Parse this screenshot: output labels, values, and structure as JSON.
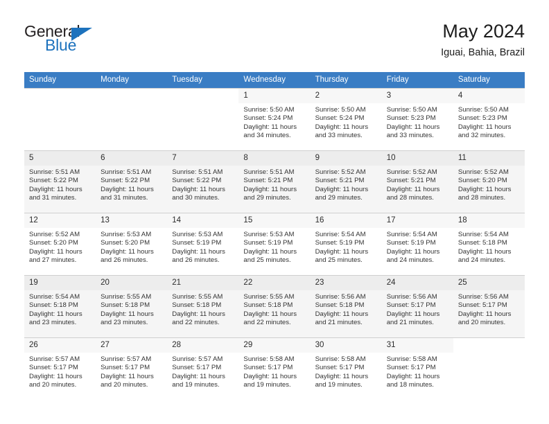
{
  "brand": {
    "name_top": "General",
    "name_bottom": "Blue",
    "triangle_color": "#1d72bd",
    "text_color": "#231f20"
  },
  "header": {
    "title": "May 2024",
    "subtitle": "Iguai, Bahia, Brazil"
  },
  "calendar": {
    "header_background": "#3a7dc4",
    "header_text_color": "#ffffff",
    "weekdays": [
      "Sunday",
      "Monday",
      "Tuesday",
      "Wednesday",
      "Thursday",
      "Friday",
      "Saturday"
    ],
    "labels": {
      "sunrise": "Sunrise:",
      "sunset": "Sunset:",
      "daylight": "Daylight:"
    },
    "weeks": [
      {
        "shaded": false,
        "days": [
          {
            "day": "",
            "sunrise": "",
            "sunset": "",
            "daylight_line1": "",
            "daylight_line2": ""
          },
          {
            "day": "",
            "sunrise": "",
            "sunset": "",
            "daylight_line1": "",
            "daylight_line2": ""
          },
          {
            "day": "",
            "sunrise": "",
            "sunset": "",
            "daylight_line1": "",
            "daylight_line2": ""
          },
          {
            "day": "1",
            "sunrise": "Sunrise: 5:50 AM",
            "sunset": "Sunset: 5:24 PM",
            "daylight_line1": "Daylight: 11 hours",
            "daylight_line2": "and 34 minutes."
          },
          {
            "day": "2",
            "sunrise": "Sunrise: 5:50 AM",
            "sunset": "Sunset: 5:24 PM",
            "daylight_line1": "Daylight: 11 hours",
            "daylight_line2": "and 33 minutes."
          },
          {
            "day": "3",
            "sunrise": "Sunrise: 5:50 AM",
            "sunset": "Sunset: 5:23 PM",
            "daylight_line1": "Daylight: 11 hours",
            "daylight_line2": "and 33 minutes."
          },
          {
            "day": "4",
            "sunrise": "Sunrise: 5:50 AM",
            "sunset": "Sunset: 5:23 PM",
            "daylight_line1": "Daylight: 11 hours",
            "daylight_line2": "and 32 minutes."
          }
        ]
      },
      {
        "shaded": true,
        "days": [
          {
            "day": "5",
            "sunrise": "Sunrise: 5:51 AM",
            "sunset": "Sunset: 5:22 PM",
            "daylight_line1": "Daylight: 11 hours",
            "daylight_line2": "and 31 minutes."
          },
          {
            "day": "6",
            "sunrise": "Sunrise: 5:51 AM",
            "sunset": "Sunset: 5:22 PM",
            "daylight_line1": "Daylight: 11 hours",
            "daylight_line2": "and 31 minutes."
          },
          {
            "day": "7",
            "sunrise": "Sunrise: 5:51 AM",
            "sunset": "Sunset: 5:22 PM",
            "daylight_line1": "Daylight: 11 hours",
            "daylight_line2": "and 30 minutes."
          },
          {
            "day": "8",
            "sunrise": "Sunrise: 5:51 AM",
            "sunset": "Sunset: 5:21 PM",
            "daylight_line1": "Daylight: 11 hours",
            "daylight_line2": "and 29 minutes."
          },
          {
            "day": "9",
            "sunrise": "Sunrise: 5:52 AM",
            "sunset": "Sunset: 5:21 PM",
            "daylight_line1": "Daylight: 11 hours",
            "daylight_line2": "and 29 minutes."
          },
          {
            "day": "10",
            "sunrise": "Sunrise: 5:52 AM",
            "sunset": "Sunset: 5:21 PM",
            "daylight_line1": "Daylight: 11 hours",
            "daylight_line2": "and 28 minutes."
          },
          {
            "day": "11",
            "sunrise": "Sunrise: 5:52 AM",
            "sunset": "Sunset: 5:20 PM",
            "daylight_line1": "Daylight: 11 hours",
            "daylight_line2": "and 28 minutes."
          }
        ]
      },
      {
        "shaded": false,
        "days": [
          {
            "day": "12",
            "sunrise": "Sunrise: 5:52 AM",
            "sunset": "Sunset: 5:20 PM",
            "daylight_line1": "Daylight: 11 hours",
            "daylight_line2": "and 27 minutes."
          },
          {
            "day": "13",
            "sunrise": "Sunrise: 5:53 AM",
            "sunset": "Sunset: 5:20 PM",
            "daylight_line1": "Daylight: 11 hours",
            "daylight_line2": "and 26 minutes."
          },
          {
            "day": "14",
            "sunrise": "Sunrise: 5:53 AM",
            "sunset": "Sunset: 5:19 PM",
            "daylight_line1": "Daylight: 11 hours",
            "daylight_line2": "and 26 minutes."
          },
          {
            "day": "15",
            "sunrise": "Sunrise: 5:53 AM",
            "sunset": "Sunset: 5:19 PM",
            "daylight_line1": "Daylight: 11 hours",
            "daylight_line2": "and 25 minutes."
          },
          {
            "day": "16",
            "sunrise": "Sunrise: 5:54 AM",
            "sunset": "Sunset: 5:19 PM",
            "daylight_line1": "Daylight: 11 hours",
            "daylight_line2": "and 25 minutes."
          },
          {
            "day": "17",
            "sunrise": "Sunrise: 5:54 AM",
            "sunset": "Sunset: 5:19 PM",
            "daylight_line1": "Daylight: 11 hours",
            "daylight_line2": "and 24 minutes."
          },
          {
            "day": "18",
            "sunrise": "Sunrise: 5:54 AM",
            "sunset": "Sunset: 5:18 PM",
            "daylight_line1": "Daylight: 11 hours",
            "daylight_line2": "and 24 minutes."
          }
        ]
      },
      {
        "shaded": true,
        "days": [
          {
            "day": "19",
            "sunrise": "Sunrise: 5:54 AM",
            "sunset": "Sunset: 5:18 PM",
            "daylight_line1": "Daylight: 11 hours",
            "daylight_line2": "and 23 minutes."
          },
          {
            "day": "20",
            "sunrise": "Sunrise: 5:55 AM",
            "sunset": "Sunset: 5:18 PM",
            "daylight_line1": "Daylight: 11 hours",
            "daylight_line2": "and 23 minutes."
          },
          {
            "day": "21",
            "sunrise": "Sunrise: 5:55 AM",
            "sunset": "Sunset: 5:18 PM",
            "daylight_line1": "Daylight: 11 hours",
            "daylight_line2": "and 22 minutes."
          },
          {
            "day": "22",
            "sunrise": "Sunrise: 5:55 AM",
            "sunset": "Sunset: 5:18 PM",
            "daylight_line1": "Daylight: 11 hours",
            "daylight_line2": "and 22 minutes."
          },
          {
            "day": "23",
            "sunrise": "Sunrise: 5:56 AM",
            "sunset": "Sunset: 5:18 PM",
            "daylight_line1": "Daylight: 11 hours",
            "daylight_line2": "and 21 minutes."
          },
          {
            "day": "24",
            "sunrise": "Sunrise: 5:56 AM",
            "sunset": "Sunset: 5:17 PM",
            "daylight_line1": "Daylight: 11 hours",
            "daylight_line2": "and 21 minutes."
          },
          {
            "day": "25",
            "sunrise": "Sunrise: 5:56 AM",
            "sunset": "Sunset: 5:17 PM",
            "daylight_line1": "Daylight: 11 hours",
            "daylight_line2": "and 20 minutes."
          }
        ]
      },
      {
        "shaded": false,
        "days": [
          {
            "day": "26",
            "sunrise": "Sunrise: 5:57 AM",
            "sunset": "Sunset: 5:17 PM",
            "daylight_line1": "Daylight: 11 hours",
            "daylight_line2": "and 20 minutes."
          },
          {
            "day": "27",
            "sunrise": "Sunrise: 5:57 AM",
            "sunset": "Sunset: 5:17 PM",
            "daylight_line1": "Daylight: 11 hours",
            "daylight_line2": "and 20 minutes."
          },
          {
            "day": "28",
            "sunrise": "Sunrise: 5:57 AM",
            "sunset": "Sunset: 5:17 PM",
            "daylight_line1": "Daylight: 11 hours",
            "daylight_line2": "and 19 minutes."
          },
          {
            "day": "29",
            "sunrise": "Sunrise: 5:58 AM",
            "sunset": "Sunset: 5:17 PM",
            "daylight_line1": "Daylight: 11 hours",
            "daylight_line2": "and 19 minutes."
          },
          {
            "day": "30",
            "sunrise": "Sunrise: 5:58 AM",
            "sunset": "Sunset: 5:17 PM",
            "daylight_line1": "Daylight: 11 hours",
            "daylight_line2": "and 19 minutes."
          },
          {
            "day": "31",
            "sunrise": "Sunrise: 5:58 AM",
            "sunset": "Sunset: 5:17 PM",
            "daylight_line1": "Daylight: 11 hours",
            "daylight_line2": "and 18 minutes."
          },
          {
            "day": "",
            "sunrise": "",
            "sunset": "",
            "daylight_line1": "",
            "daylight_line2": ""
          }
        ]
      }
    ]
  }
}
